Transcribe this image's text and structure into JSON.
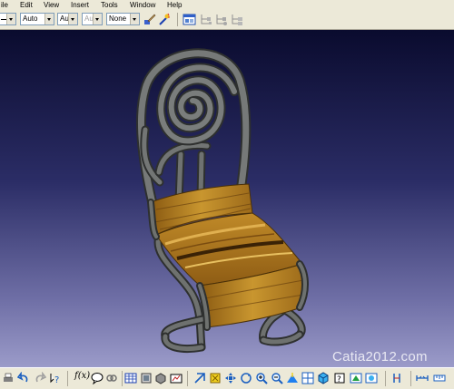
{
  "menu": {
    "file": "ile",
    "edit": "Edit",
    "view": "View",
    "insert": "Insert",
    "tools": "Tools",
    "window": "Window",
    "help": "Help"
  },
  "toolbar": {
    "linetype_value": "",
    "thickness_value": "Auto",
    "color_value": "Aut",
    "transparency_value": "Aut",
    "layer_value": "None"
  },
  "bottom_toolbar": {
    "formula_label": "f(x)"
  },
  "watermark": "Catia2012.com",
  "colors": {
    "metal_frame": "#6e716f",
    "wood": "#b8862b",
    "viewport_top": "#0a0b2e",
    "viewport_bottom": "#9b9bc9"
  }
}
